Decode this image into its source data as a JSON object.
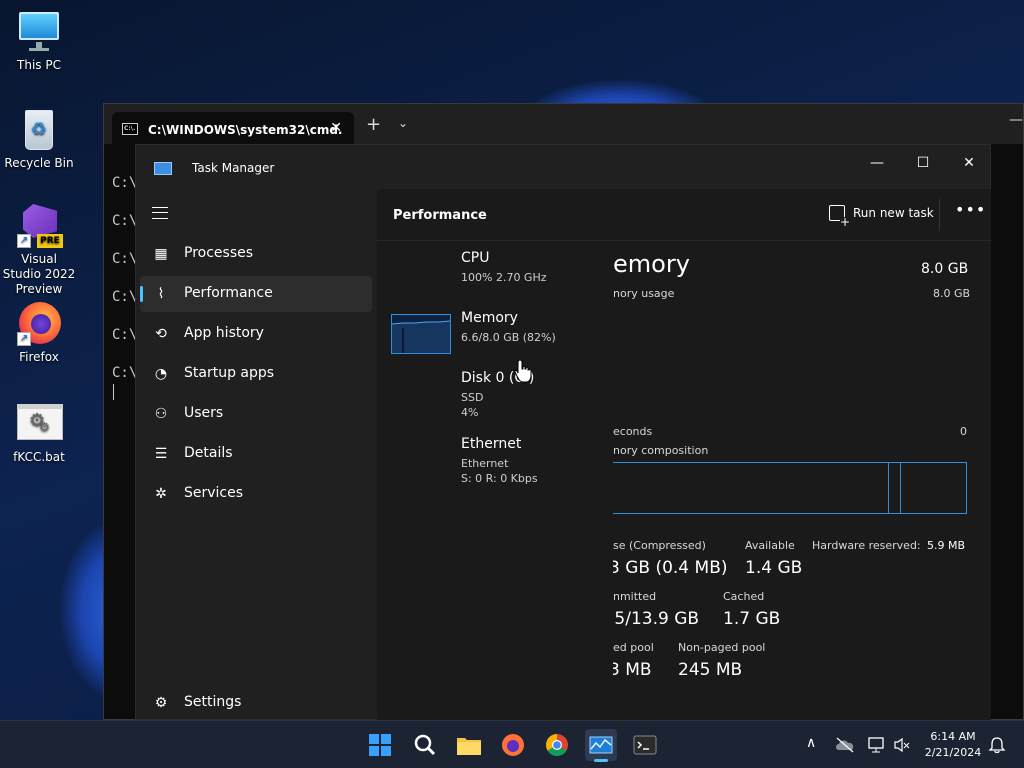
{
  "desktop": {
    "icons": [
      {
        "label": "This PC",
        "icon": "monitor-icon"
      },
      {
        "label": "Recycle Bin",
        "icon": "recycle-bin-icon"
      },
      {
        "label": "Visual Studio 2022 Preview",
        "icon": "visual-studio-icon",
        "badge": "PRE"
      },
      {
        "label": "Firefox",
        "icon": "firefox-icon"
      },
      {
        "label": "fKCC.bat",
        "icon": "batch-file-icon"
      }
    ]
  },
  "terminal": {
    "tab_title": "C:\\WINDOWS\\system32\\cmd.",
    "tab_icon_text": "C:\\.",
    "prompt_lines": [
      "C:\\",
      "C:\\",
      "C:\\",
      "C:\\",
      "C:\\",
      "C:\\"
    ],
    "new_tab": "+",
    "dropdown": "⌄",
    "minimize": "—",
    "close_tab": "✕"
  },
  "taskmanager": {
    "title": "Task Manager",
    "window_controls": {
      "minimize": "—",
      "maximize": "☐",
      "close": "✕"
    },
    "nav": [
      {
        "label": "Processes",
        "icon": "processes-icon",
        "glyph": "▦"
      },
      {
        "label": "Performance",
        "icon": "performance-icon",
        "glyph": "⌇",
        "active": true
      },
      {
        "label": "App history",
        "icon": "app-history-icon",
        "glyph": "⟲"
      },
      {
        "label": "Startup apps",
        "icon": "startup-icon",
        "glyph": "◔"
      },
      {
        "label": "Users",
        "icon": "users-icon",
        "glyph": "⚇"
      },
      {
        "label": "Details",
        "icon": "details-icon",
        "glyph": "☰"
      },
      {
        "label": "Services",
        "icon": "services-icon",
        "glyph": "✲"
      }
    ],
    "settings_label": "Settings",
    "settings_glyph": "⚙",
    "header": {
      "title": "Performance",
      "run_new_task": "Run new task",
      "more": "•••"
    },
    "resources": [
      {
        "name": "CPU",
        "sub1": "100%  2.70 GHz",
        "sub2": ""
      },
      {
        "name": "Memory",
        "sub1": "6.6/8.0 GB (82%)",
        "sub2": "",
        "selected": true
      },
      {
        "name": "Disk 0 (C:)",
        "sub1": "SSD",
        "sub2": "4%"
      },
      {
        "name": "Ethernet",
        "sub1": "Ethernet",
        "sub2": "S: 0  R: 0 Kbps"
      }
    ],
    "memory_detail": {
      "title_partial": "emory",
      "total": "8.0 GB",
      "usage_label_partial": "nory usage",
      "usage_max": "8.0 GB",
      "seconds_label_partial": "econds",
      "seconds_value": "0",
      "composition_label_partial": "nory composition",
      "in_use_label_partial": "se (Compressed)",
      "in_use_value_partial": "3 GB (0.4 MB)",
      "available_label": "Available",
      "available_value": "1.4 GB",
      "hw_reserved_label": "Hardware reserved:",
      "hw_reserved_value": "5.9 MB",
      "committed_label_partial": "nmitted",
      "committed_value_partial": ".5/13.9 GB",
      "cached_label": "Cached",
      "cached_value": "1.7 GB",
      "paged_label_partial": "ed pool",
      "paged_value_partial": "3 MB",
      "nonpaged_label": "Non-paged pool",
      "nonpaged_value": "245 MB"
    }
  },
  "taskbar": {
    "items": [
      "start-button",
      "search-button",
      "file-explorer",
      "firefox",
      "chrome",
      "task-manager",
      "terminal"
    ],
    "clock_time": "6:14 AM",
    "clock_date": "2/21/2024",
    "tray_chevron": "∧"
  },
  "colors": {
    "accent": "#4cc2ff",
    "memory_line": "#2f8fd8",
    "taskbar": "#1c2433"
  }
}
